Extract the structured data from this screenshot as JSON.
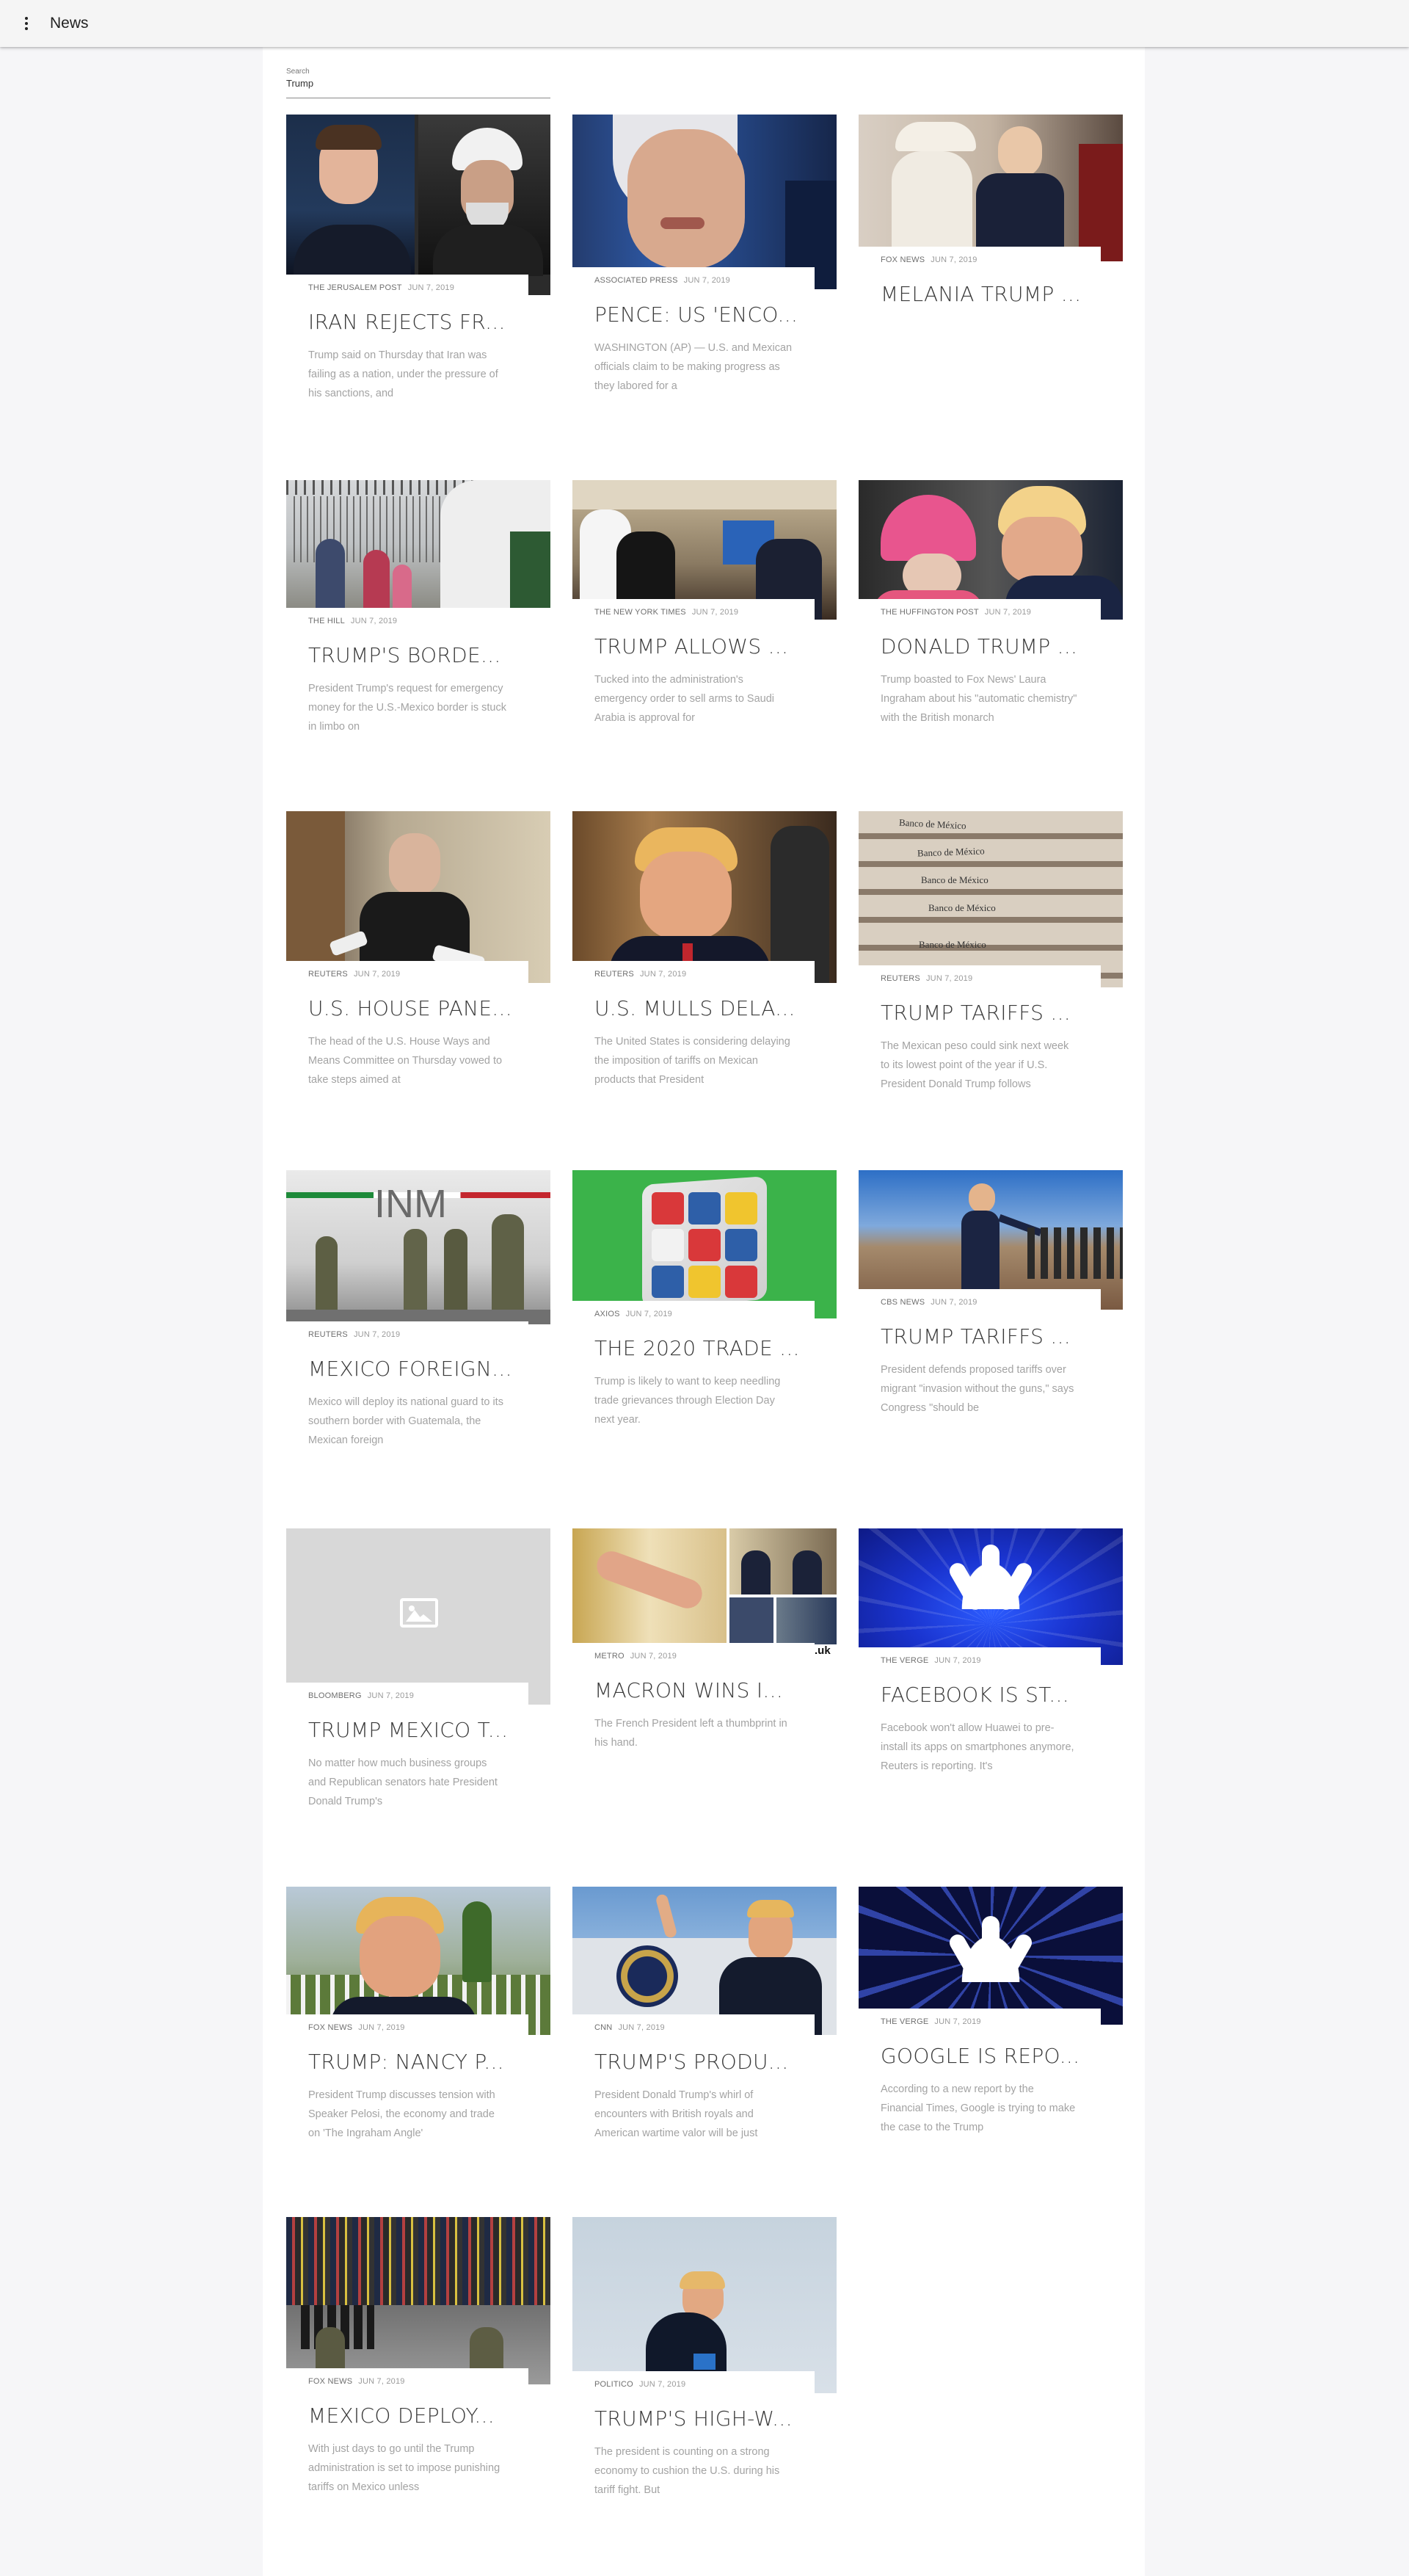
{
  "app": {
    "title": "News",
    "menu_icon": "more-vert-icon"
  },
  "search": {
    "label": "Search",
    "value": "Trump"
  },
  "articles": [
    {
      "source": "THE JERUSALEM POST",
      "date": "JUN 7, 2019",
      "headline": "IRAN REJECTS FR...",
      "snippet": "Trump said on Thursday that Iran was failing as a nation, under the pressure of his sanctions, and"
    },
    {
      "source": "ASSOCIATED PRESS",
      "date": "JUN 7, 2019",
      "headline": "PENCE: US 'ENCO...",
      "snippet": "WASHINGTON (AP) — U.S. and Mexican officials claim to be making progress as they labored for a"
    },
    {
      "source": "FOX NEWS",
      "date": "JUN 7, 2019",
      "headline": "MELANIA TRUMP ...",
      "snippet": ""
    },
    {
      "source": "THE HILL",
      "date": "JUN 7, 2019",
      "headline": "TRUMP'S BORDE...",
      "snippet": "President Trump's request for emergency money for the U.S.-Mexico border is stuck in limbo on"
    },
    {
      "source": "THE NEW YORK TIMES",
      "date": "JUN 7, 2019",
      "headline": "TRUMP ALLOWS ...",
      "snippet": "Tucked into the administration's emergency order to sell arms to Saudi Arabia is approval for"
    },
    {
      "source": "THE HUFFINGTON POST",
      "date": "JUN 7, 2019",
      "headline": "DONALD TRUMP ...",
      "snippet": "Trump boasted to Fox News' Laura Ingraham about his \"automatic chemistry\" with the British monarch"
    },
    {
      "source": "REUTERS",
      "date": "JUN 7, 2019",
      "headline": "U.S. HOUSE PANE...",
      "snippet": "The head of the U.S. House Ways and Means Committee on Thursday vowed to take steps aimed at"
    },
    {
      "source": "REUTERS",
      "date": "JUN 7, 2019",
      "headline": "U.S. MULLS DELA...",
      "snippet": "The United States is considering delaying the imposition of tariffs on Mexican products that President"
    },
    {
      "source": "REUTERS",
      "date": "JUN 7, 2019",
      "headline": "TRUMP TARIFFS ...",
      "snippet": "The Mexican peso could sink next week to its lowest point of the year if U.S. President Donald Trump follows"
    },
    {
      "source": "REUTERS",
      "date": "JUN 7, 2019",
      "headline": "MEXICO FOREIGN...",
      "snippet": "Mexico will deploy its national guard to its southern border with Guatemala, the Mexican foreign"
    },
    {
      "source": "AXIOS",
      "date": "JUN 7, 2019",
      "headline": "THE 2020 TRADE ...",
      "snippet": "Trump is likely to want to keep needling trade grievances through Election Day next year."
    },
    {
      "source": "CBS NEWS",
      "date": "JUN 7, 2019",
      "headline": "TRUMP TARIFFS ...",
      "snippet": "President defends proposed tariffs over migrant \"invasion without the guns,\" says Congress \"should be"
    },
    {
      "source": "BLOOMBERG",
      "date": "JUN 7, 2019",
      "headline": "TRUMP MEXICO T...",
      "snippet": "No matter how much business groups and Republican senators hate President Donald Trump's"
    },
    {
      "source": "METRO",
      "date": "JUN 7, 2019",
      "headline": "MACRON WINS I...",
      "snippet": "The French President left a thumbprint in his hand."
    },
    {
      "source": "THE VERGE",
      "date": "JUN 7, 2019",
      "headline": "FACEBOOK IS ST...",
      "snippet": "Facebook won't allow Huawei to pre-install its apps on smartphones anymore, Reuters is reporting. It's"
    },
    {
      "source": "FOX NEWS",
      "date": "JUN 7, 2019",
      "headline": "TRUMP: NANCY P...",
      "snippet": "President Trump discusses tension with Speaker Pelosi, the economy and trade on 'The Ingraham Angle'"
    },
    {
      "source": "CNN",
      "date": "JUN 7, 2019",
      "headline": "TRUMP'S PRODU...",
      "snippet": "President Donald Trump's whirl of encounters with British royals and American wartime valor will be just"
    },
    {
      "source": "THE VERGE",
      "date": "JUN 7, 2019",
      "headline": "GOOGLE IS REPO...",
      "snippet": "According to a new report by the Financial Times, Google is trying to make the case to the Trump"
    },
    {
      "source": "FOX NEWS",
      "date": "JUN 7, 2019",
      "headline": "MEXICO DEPLOY...",
      "snippet": "With just days to go until the Trump administration is set to impose punishing tariffs on Mexico unless"
    },
    {
      "source": "POLITICO",
      "date": "JUN 7, 2019",
      "headline": "TRUMP'S HIGH-W...",
      "snippet": "The president is counting on a strong economy to cushion the U.S. during his tariff fight. But"
    }
  ],
  "image_icons": [
    "image-placeholder-icon"
  ],
  "bank_labels": [
    "Banco de México",
    "Banco de México",
    "Banco de México",
    "Banco de México",
    "Banco de México"
  ],
  "image_caption_fragment": ".uk",
  "colors": {
    "appbar": "#f5f5f5",
    "page_bg": "#f6f6f8",
    "content_bg": "#ffffff",
    "headline": "#3a3a3a",
    "snippet": "#a3a3a3"
  }
}
